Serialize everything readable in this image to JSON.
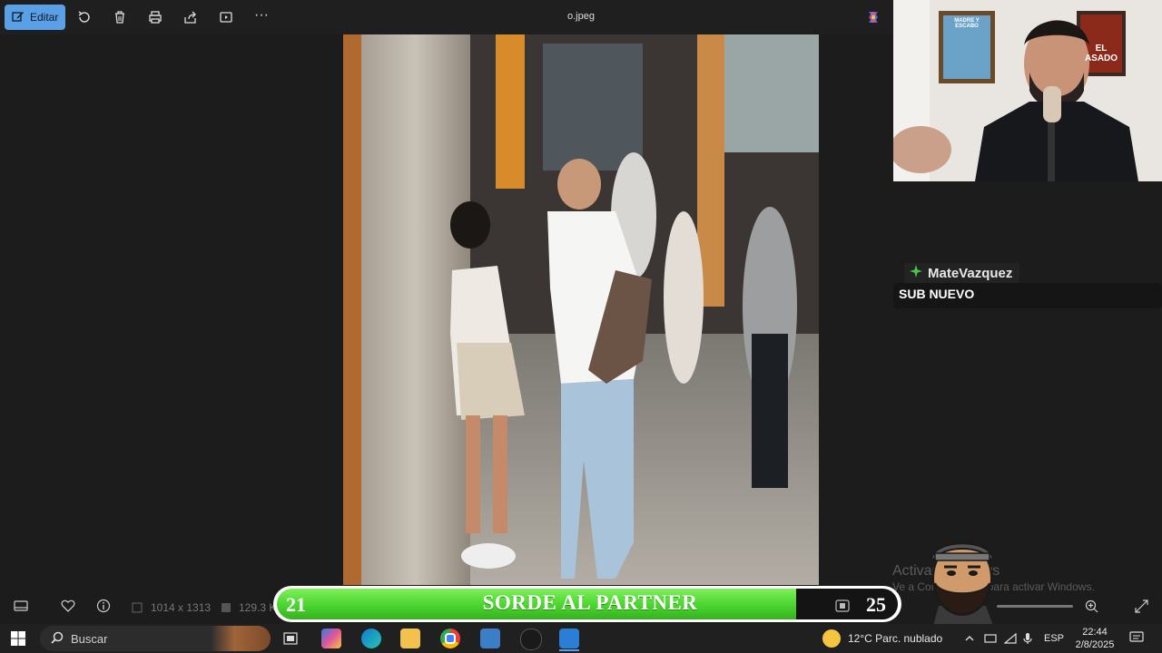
{
  "toolbar": {
    "edit_label": "Editar",
    "file_name": "o.jpeg",
    "more_label": "···"
  },
  "chat": {
    "username": "MateVazquez",
    "message": "SUB NUEVO"
  },
  "infobar": {
    "dimensions": "1014 x 1313",
    "size": "129.3 K"
  },
  "banner": {
    "left_number": "21",
    "text": "SORDE AL PARTNER",
    "right_number": "25"
  },
  "webcam_posters": {
    "poster_left_top": "MADRE Y ESCABO",
    "poster_right": "EL ASADO"
  },
  "watermark": {
    "line1": "Activar Windows",
    "line2": "Ve a Configuración para activar Windows."
  },
  "taskbar": {
    "search_placeholder": "Buscar",
    "weather": "12°C  Parc. nublado",
    "language": "ESP",
    "time": "22:44",
    "date": "2/8/2025"
  },
  "colors": {
    "accent": "#5aa0e6",
    "banner_green": "#4bd42f",
    "chat_star": "#49c645"
  }
}
